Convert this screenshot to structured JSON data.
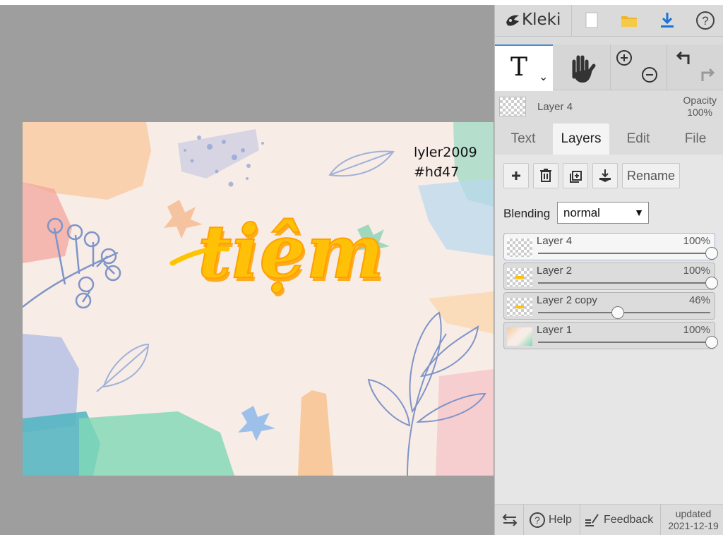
{
  "app": {
    "name": "Kleki"
  },
  "toolbar": {
    "new_icon": "new-file-icon",
    "open_icon": "folder-icon",
    "save_icon": "download-icon",
    "help_icon": "help-icon"
  },
  "tools": {
    "text_tool_glyph": "T",
    "hand_icon": "hand-icon",
    "zoom_in_icon": "zoom-in-icon",
    "zoom_out_icon": "zoom-out-icon",
    "undo_icon": "undo-icon",
    "redo_icon": "redo-icon"
  },
  "current_layer": {
    "name": "Layer 4",
    "opacity_label": "Opacity",
    "opacity_value": "100%"
  },
  "tabs": [
    {
      "label": "Text",
      "active": false
    },
    {
      "label": "Layers",
      "active": true
    },
    {
      "label": "Edit",
      "active": false
    },
    {
      "label": "File",
      "active": false
    }
  ],
  "layer_controls": {
    "rename_label": "Rename"
  },
  "blending": {
    "label": "Blending",
    "value": "normal"
  },
  "layers": [
    {
      "name": "Layer 4",
      "opacity": "100%",
      "opacity_value": 1.0,
      "selected": true
    },
    {
      "name": "Layer 2",
      "opacity": "100%",
      "opacity_value": 1.0,
      "selected": false
    },
    {
      "name": "Layer 2 copy",
      "opacity": "46%",
      "opacity_value": 0.46,
      "selected": false
    },
    {
      "name": "Layer 1",
      "opacity": "100%",
      "opacity_value": 1.0,
      "selected": false
    }
  ],
  "canvas_text": {
    "line1": "lyler2009",
    "line2": "#hđ47",
    "title": "tiệm"
  },
  "bottom": {
    "help_label": "Help",
    "feedback_label": "Feedback",
    "updated_label": "updated",
    "updated_date": "2021-12-19"
  },
  "colors": {
    "accent": "#4b8bd4",
    "title_yellow": "#ffc107",
    "panel_bg": "#dcdcdc"
  }
}
